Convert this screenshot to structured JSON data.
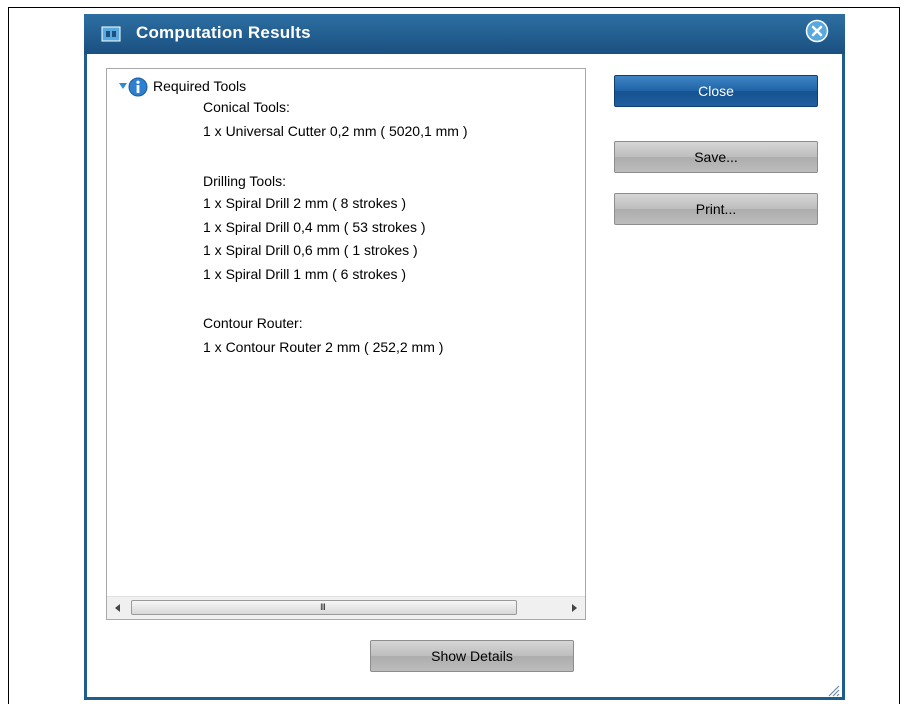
{
  "window": {
    "title": "Computation Results"
  },
  "tree": {
    "root_label": "Required Tools",
    "lines": [
      {
        "text": "Conical Tools:"
      },
      {
        "text": "1 x Universal Cutter 0,2 mm ( 5020,1 mm )"
      },
      {
        "text": ""
      },
      {
        "text": "Drilling Tools:"
      },
      {
        "text": "1 x Spiral Drill  2 mm ( 8 strokes )"
      },
      {
        "text": "1 x Spiral Drill  0,4 mm ( 53 strokes )"
      },
      {
        "text": "1 x Spiral Drill  0,6 mm ( 1 strokes )"
      },
      {
        "text": "1 x Spiral Drill  1 mm ( 6 strokes )"
      },
      {
        "text": ""
      },
      {
        "text": "Contour Router:"
      },
      {
        "text": "1 x Contour Router 2 mm ( 252,2 mm )"
      }
    ]
  },
  "buttons": {
    "close": "Close",
    "save": "Save...",
    "print": "Print...",
    "show_details": "Show Details"
  },
  "scrollbar": {
    "grip": "III"
  },
  "icons": {
    "app": "board-icon",
    "close": "close-icon",
    "info": "info-icon",
    "expand": "triangle-down-icon"
  },
  "colors": {
    "title_bar": "#1a5080",
    "accent_button": "#1f63a6",
    "dialog_border": "#1f5e8c"
  }
}
